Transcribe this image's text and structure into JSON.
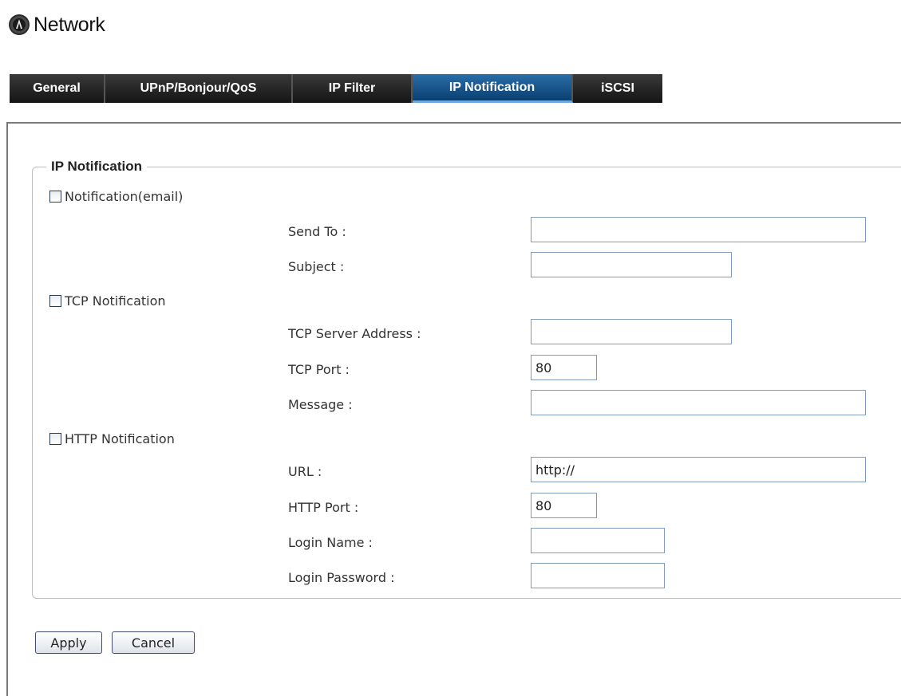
{
  "page": {
    "title": "Network",
    "icon": "network-icon"
  },
  "tabs": [
    {
      "label": "General",
      "active": false
    },
    {
      "label": "UPnP/Bonjour/QoS",
      "active": false
    },
    {
      "label": "IP Filter",
      "active": false
    },
    {
      "label": "IP Notification",
      "active": true
    },
    {
      "label": "iSCSI",
      "active": false
    }
  ],
  "section": {
    "legend": "IP Notification"
  },
  "email": {
    "checkbox_label": "Notification(email)",
    "checked": false,
    "send_to": {
      "label": "Send To :",
      "value": ""
    },
    "subject": {
      "label": "Subject :",
      "value": ""
    }
  },
  "tcp": {
    "checkbox_label": "TCP Notification",
    "checked": false,
    "server_address": {
      "label": "TCP Server Address :",
      "value": ""
    },
    "port": {
      "label": "TCP Port :",
      "value": "80"
    },
    "message": {
      "label": "Message :",
      "value": ""
    }
  },
  "http": {
    "checkbox_label": "HTTP Notification",
    "checked": false,
    "url": {
      "label": "URL :",
      "value": "http://"
    },
    "port": {
      "label": "HTTP Port :",
      "value": "80"
    },
    "login_name": {
      "label": "Login Name :",
      "value": ""
    },
    "login_password": {
      "label": "Login Password :",
      "value": ""
    }
  },
  "buttons": {
    "apply": "Apply",
    "cancel": "Cancel"
  },
  "colors": {
    "active_tab": "#0a3f70",
    "tab_bar": "#1f1f1f",
    "input_border": "#7f9db9"
  }
}
